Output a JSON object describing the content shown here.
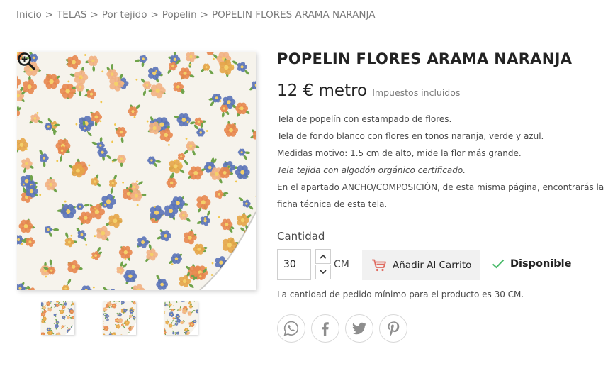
{
  "breadcrumb": [
    {
      "label": "Inicio"
    },
    {
      "label": "TELAS"
    },
    {
      "label": "Por tejido"
    },
    {
      "label": "Popelin"
    },
    {
      "label": "POPELIN FLORES ARAMA NARANJA"
    }
  ],
  "product": {
    "title": "POPELIN FLORES ARAMA NARANJA",
    "price": "12 € metro",
    "tax_note": "Impuestos incluidos",
    "description": [
      "Tela de popelín con estampado de flores.",
      "Tela de fondo blanco con flores en tonos naranja, verde y azul.",
      "Medidas motivo: 1.5 cm de alto, mide la flor más grande.",
      "Tela tejida con algodón orgánico certificado.",
      "En el apartado ANCHO/COMPOSICIÓN, de esta misma página, encontrarás la ficha técnica de esta tela."
    ]
  },
  "quantity": {
    "label": "Cantidad",
    "value": "30",
    "unit": "CM",
    "min_note": "La cantidad de pedido mínimo para el producto es 30 CM."
  },
  "actions": {
    "add_to_cart": "Añadir Al Carrito",
    "availability": "Disponible"
  },
  "share": [
    {
      "icon": "whatsapp-icon"
    },
    {
      "icon": "facebook-icon"
    },
    {
      "icon": "twitter-icon"
    },
    {
      "icon": "pinterest-icon"
    }
  ],
  "colors": {
    "accent_green": "#4cbb6c",
    "flower_orange": "#e8874f",
    "flower_blue": "#5b73b8",
    "leaf_green": "#6fa34a"
  }
}
